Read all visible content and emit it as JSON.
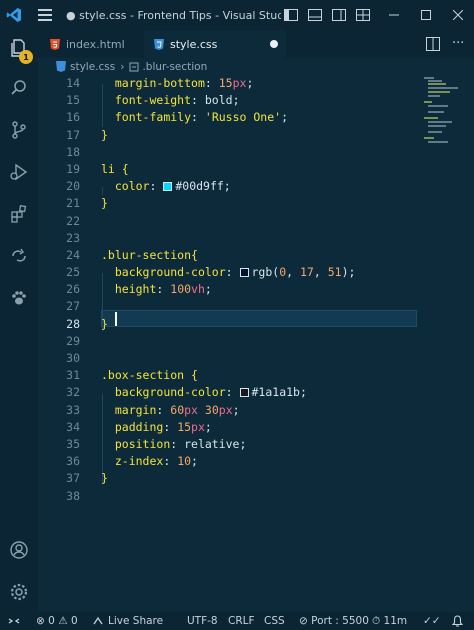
{
  "window": {
    "title": "● style.css - Frontend Tips - Visual Studio C..."
  },
  "activity": {
    "explorer_badge": "1"
  },
  "tabs": [
    {
      "label": "index.html",
      "icon": "html5-icon"
    },
    {
      "label": "style.css",
      "icon": "css-icon",
      "dirty": true
    }
  ],
  "breadcrumb": {
    "file": "style.css",
    "symbol": ".blur-section"
  },
  "editor": {
    "line_numbers": [
      "14",
      "15",
      "16",
      "17",
      "18",
      "19",
      "20",
      "21",
      "22",
      "23",
      "24",
      "25",
      "26",
      "27",
      "28",
      "29",
      "30",
      "31",
      "32",
      "33",
      "34",
      "35",
      "36",
      "37",
      "38"
    ],
    "current_line": "28",
    "lines": [
      {
        "text": "  margin-bottom: 15px;"
      },
      {
        "text": "  font-weight: bold;"
      },
      {
        "text": "  font-family: 'Russo One';"
      },
      {
        "text": "}"
      },
      {
        "text": ""
      },
      {
        "text": "li {"
      },
      {
        "text": "  color: #00d9ff;"
      },
      {
        "text": "}"
      },
      {
        "text": ""
      },
      {
        "text": ""
      },
      {
        "text": ".blur-section{"
      },
      {
        "text": "  background-color: rgb(0, 17, 51);"
      },
      {
        "text": "  height: 100vh;"
      },
      {
        "text": ""
      },
      {
        "text": "}"
      },
      {
        "text": ""
      },
      {
        "text": ""
      },
      {
        "text": ".box-section {"
      },
      {
        "text": "  background-color: #1a1a1b;"
      },
      {
        "text": "  margin: 60px 30px;"
      },
      {
        "text": "  padding: 15px;"
      },
      {
        "text": "  position: relative;"
      },
      {
        "text": "  z-index: 10;"
      },
      {
        "text": "}"
      }
    ],
    "colors": {
      "li_color": "#00d9ff",
      "blur_bg": "#001133",
      "box_bg": "#1a1a1b",
      "selector": "#f3e33a",
      "number": "#f6a66a",
      "unit": "#f26b8d"
    }
  },
  "status": {
    "errors": "0",
    "warnings": "0",
    "live_share": "Live Share",
    "encoding": "UTF-8",
    "eol": "CRLF",
    "language": "CSS",
    "port": "Port : 5500",
    "time": "11m"
  }
}
